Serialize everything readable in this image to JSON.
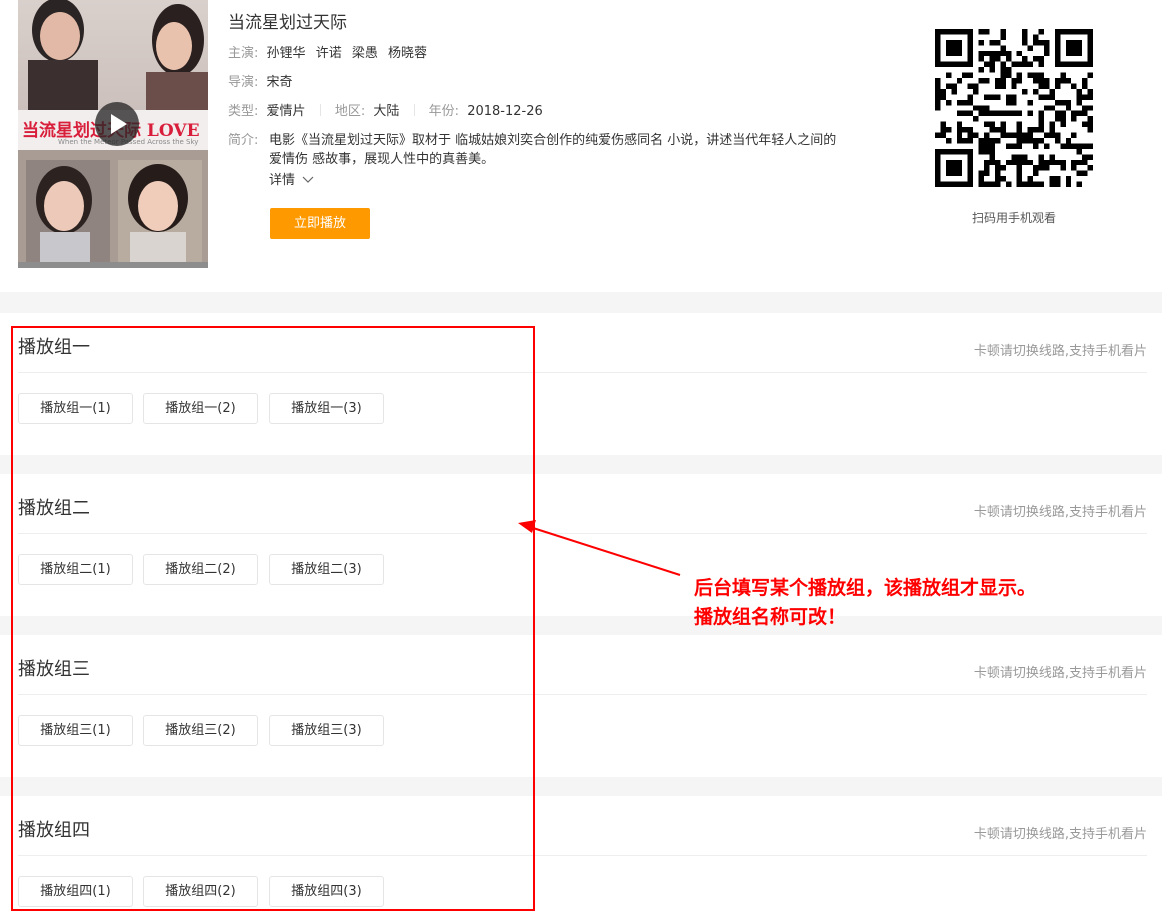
{
  "movie": {
    "title": "当流星划过天际",
    "cast_label": "主演:",
    "cast": [
      "孙锂华",
      "许诺",
      "梁愚",
      "杨晓蓉"
    ],
    "director_label": "导演:",
    "director": "宋奇",
    "genre_label": "类型:",
    "genre": "爱情片",
    "region_label": "地区:",
    "region": "大陆",
    "year_label": "年份:",
    "year": "2018-12-26",
    "intro_label": "简介:",
    "intro": "电影《当流星划过天际》取材于 临城姑娘刘奕合创作的纯爱伤感同名 小说，讲述当代年轻人之间的爱情伤 感故事，展现人性中的真善美。",
    "more_label": "详情",
    "play_label": "立即播放",
    "poster_text": "当流星划过天际 LOVE",
    "poster_subtext": "When the Meteor Passed Across the Sky"
  },
  "qr": {
    "caption": "扫码用手机观看"
  },
  "groups": [
    {
      "title": "播放组一",
      "tip": "卡顿请切换线路,支持手机看片",
      "episodes": [
        "播放组一(1)",
        "播放组一(2)",
        "播放组一(3)"
      ]
    },
    {
      "title": "播放组二",
      "tip": "卡顿请切换线路,支持手机看片",
      "episodes": [
        "播放组二(1)",
        "播放组二(2)",
        "播放组二(3)"
      ]
    },
    {
      "title": "播放组三",
      "tip": "卡顿请切换线路,支持手机看片",
      "episodes": [
        "播放组三(1)",
        "播放组三(2)",
        "播放组三(3)"
      ]
    },
    {
      "title": "播放组四",
      "tip": "卡顿请切换线路,支持手机看片",
      "episodes": [
        "播放组四(1)",
        "播放组四(2)",
        "播放组四(3)"
      ]
    }
  ],
  "annotation": {
    "line1": "后台填写某个播放组，该播放组才显示。",
    "line2": "播放组名称可改！",
    "color": "#ff0000"
  },
  "colors": {
    "accent": "#ff9900",
    "page_bg": "#f5f5f5"
  }
}
